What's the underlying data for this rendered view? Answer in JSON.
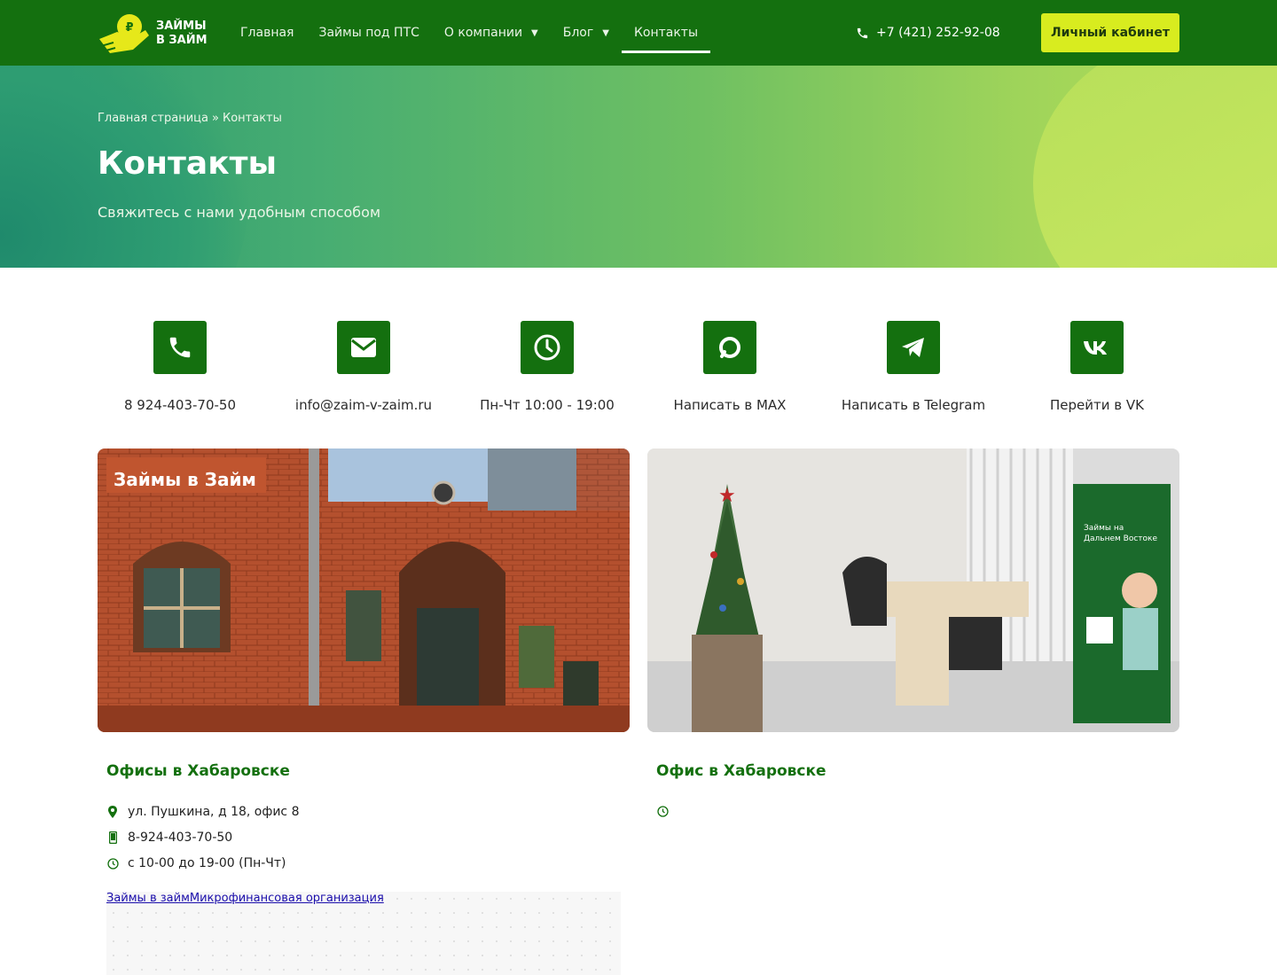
{
  "header": {
    "logo_line1": "ЗАЙМЫ",
    "logo_line2": "В ЗАЙМ",
    "nav": [
      {
        "label": "Главная"
      },
      {
        "label": "Займы под ПТС"
      },
      {
        "label": "О компании"
      },
      {
        "label": "Блог"
      },
      {
        "label": "Контакты"
      }
    ],
    "phone": "+7 (421) 252-92-08",
    "cabinet_label": "Личный кабинет",
    "colors": {
      "bg": "#14700f",
      "cta": "#d8ec1f"
    }
  },
  "hero": {
    "breadcrumb_home": "Главная страница",
    "breadcrumb_sep": "»",
    "breadcrumb_current": "Контакты",
    "title": "Контакты",
    "subtitle": "Свяжитесь с нами удобным способом"
  },
  "contacts": [
    {
      "icon": "phone-icon",
      "label": "8 924-403-70-50"
    },
    {
      "icon": "envelope-icon",
      "label": "info@zaim-v-zaim.ru"
    },
    {
      "icon": "clock-icon",
      "label": "Пн-Чт 10:00 - 19:00"
    },
    {
      "icon": "max-messenger-icon",
      "label": "Написать в MAX"
    },
    {
      "icon": "telegram-icon",
      "label": "Написать в Telegram"
    },
    {
      "icon": "vk-icon",
      "label": "Перейти в VK"
    }
  ],
  "photos": {
    "left_sign": "Займы в Займ"
  },
  "offices": [
    {
      "title": "Офисы в Хабаровске",
      "address": "ул. Пушкина, д 18, офис 8",
      "phone": "8-924-403-70-50",
      "hours": "с 10-00 до 19-00 (Пн-Чт)",
      "map_link": "Займы в займМикрофинансовая организация"
    },
    {
      "title": "Офис в Хабаровске"
    }
  ]
}
